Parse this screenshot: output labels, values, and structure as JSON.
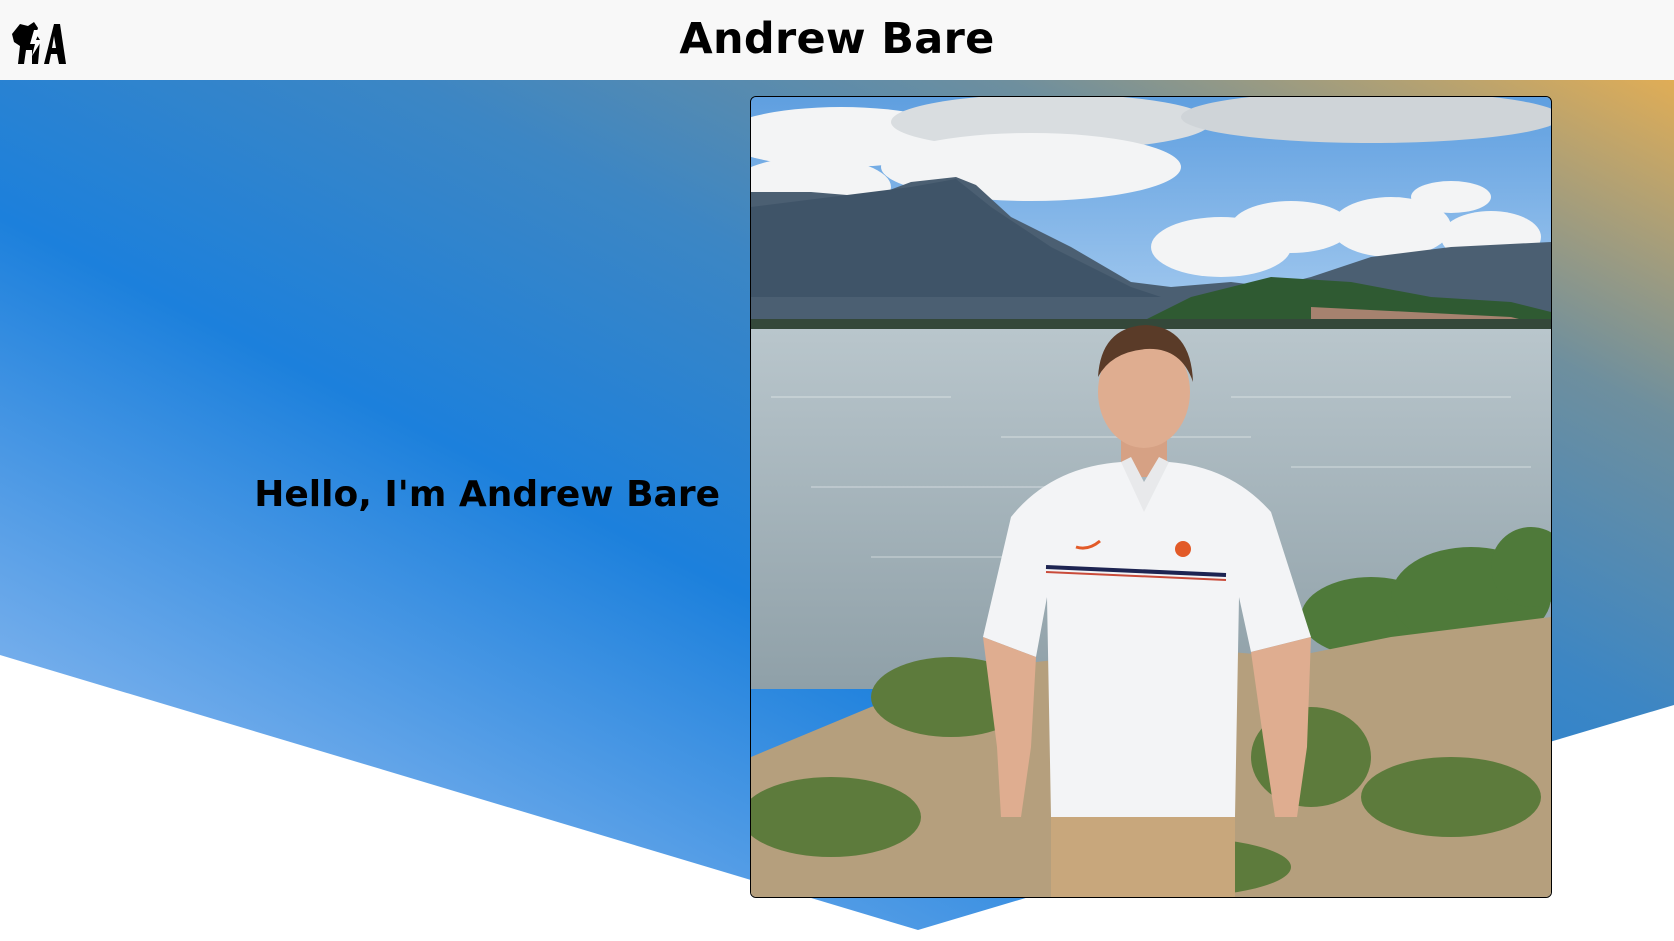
{
  "header": {
    "title": "Andrew Bare",
    "logo_icon": "bear-logo-icon"
  },
  "hero": {
    "greeting": "Hello, I'm Andrew Bare",
    "photo_alt": "Andrew Bare standing in front of a mountain lake",
    "gradient_colors": {
      "light_blue": "#a4c4f3",
      "mid_blue": "#1a7fdc",
      "slate": "#6a8ea0",
      "gold": "#e2ad52"
    }
  }
}
